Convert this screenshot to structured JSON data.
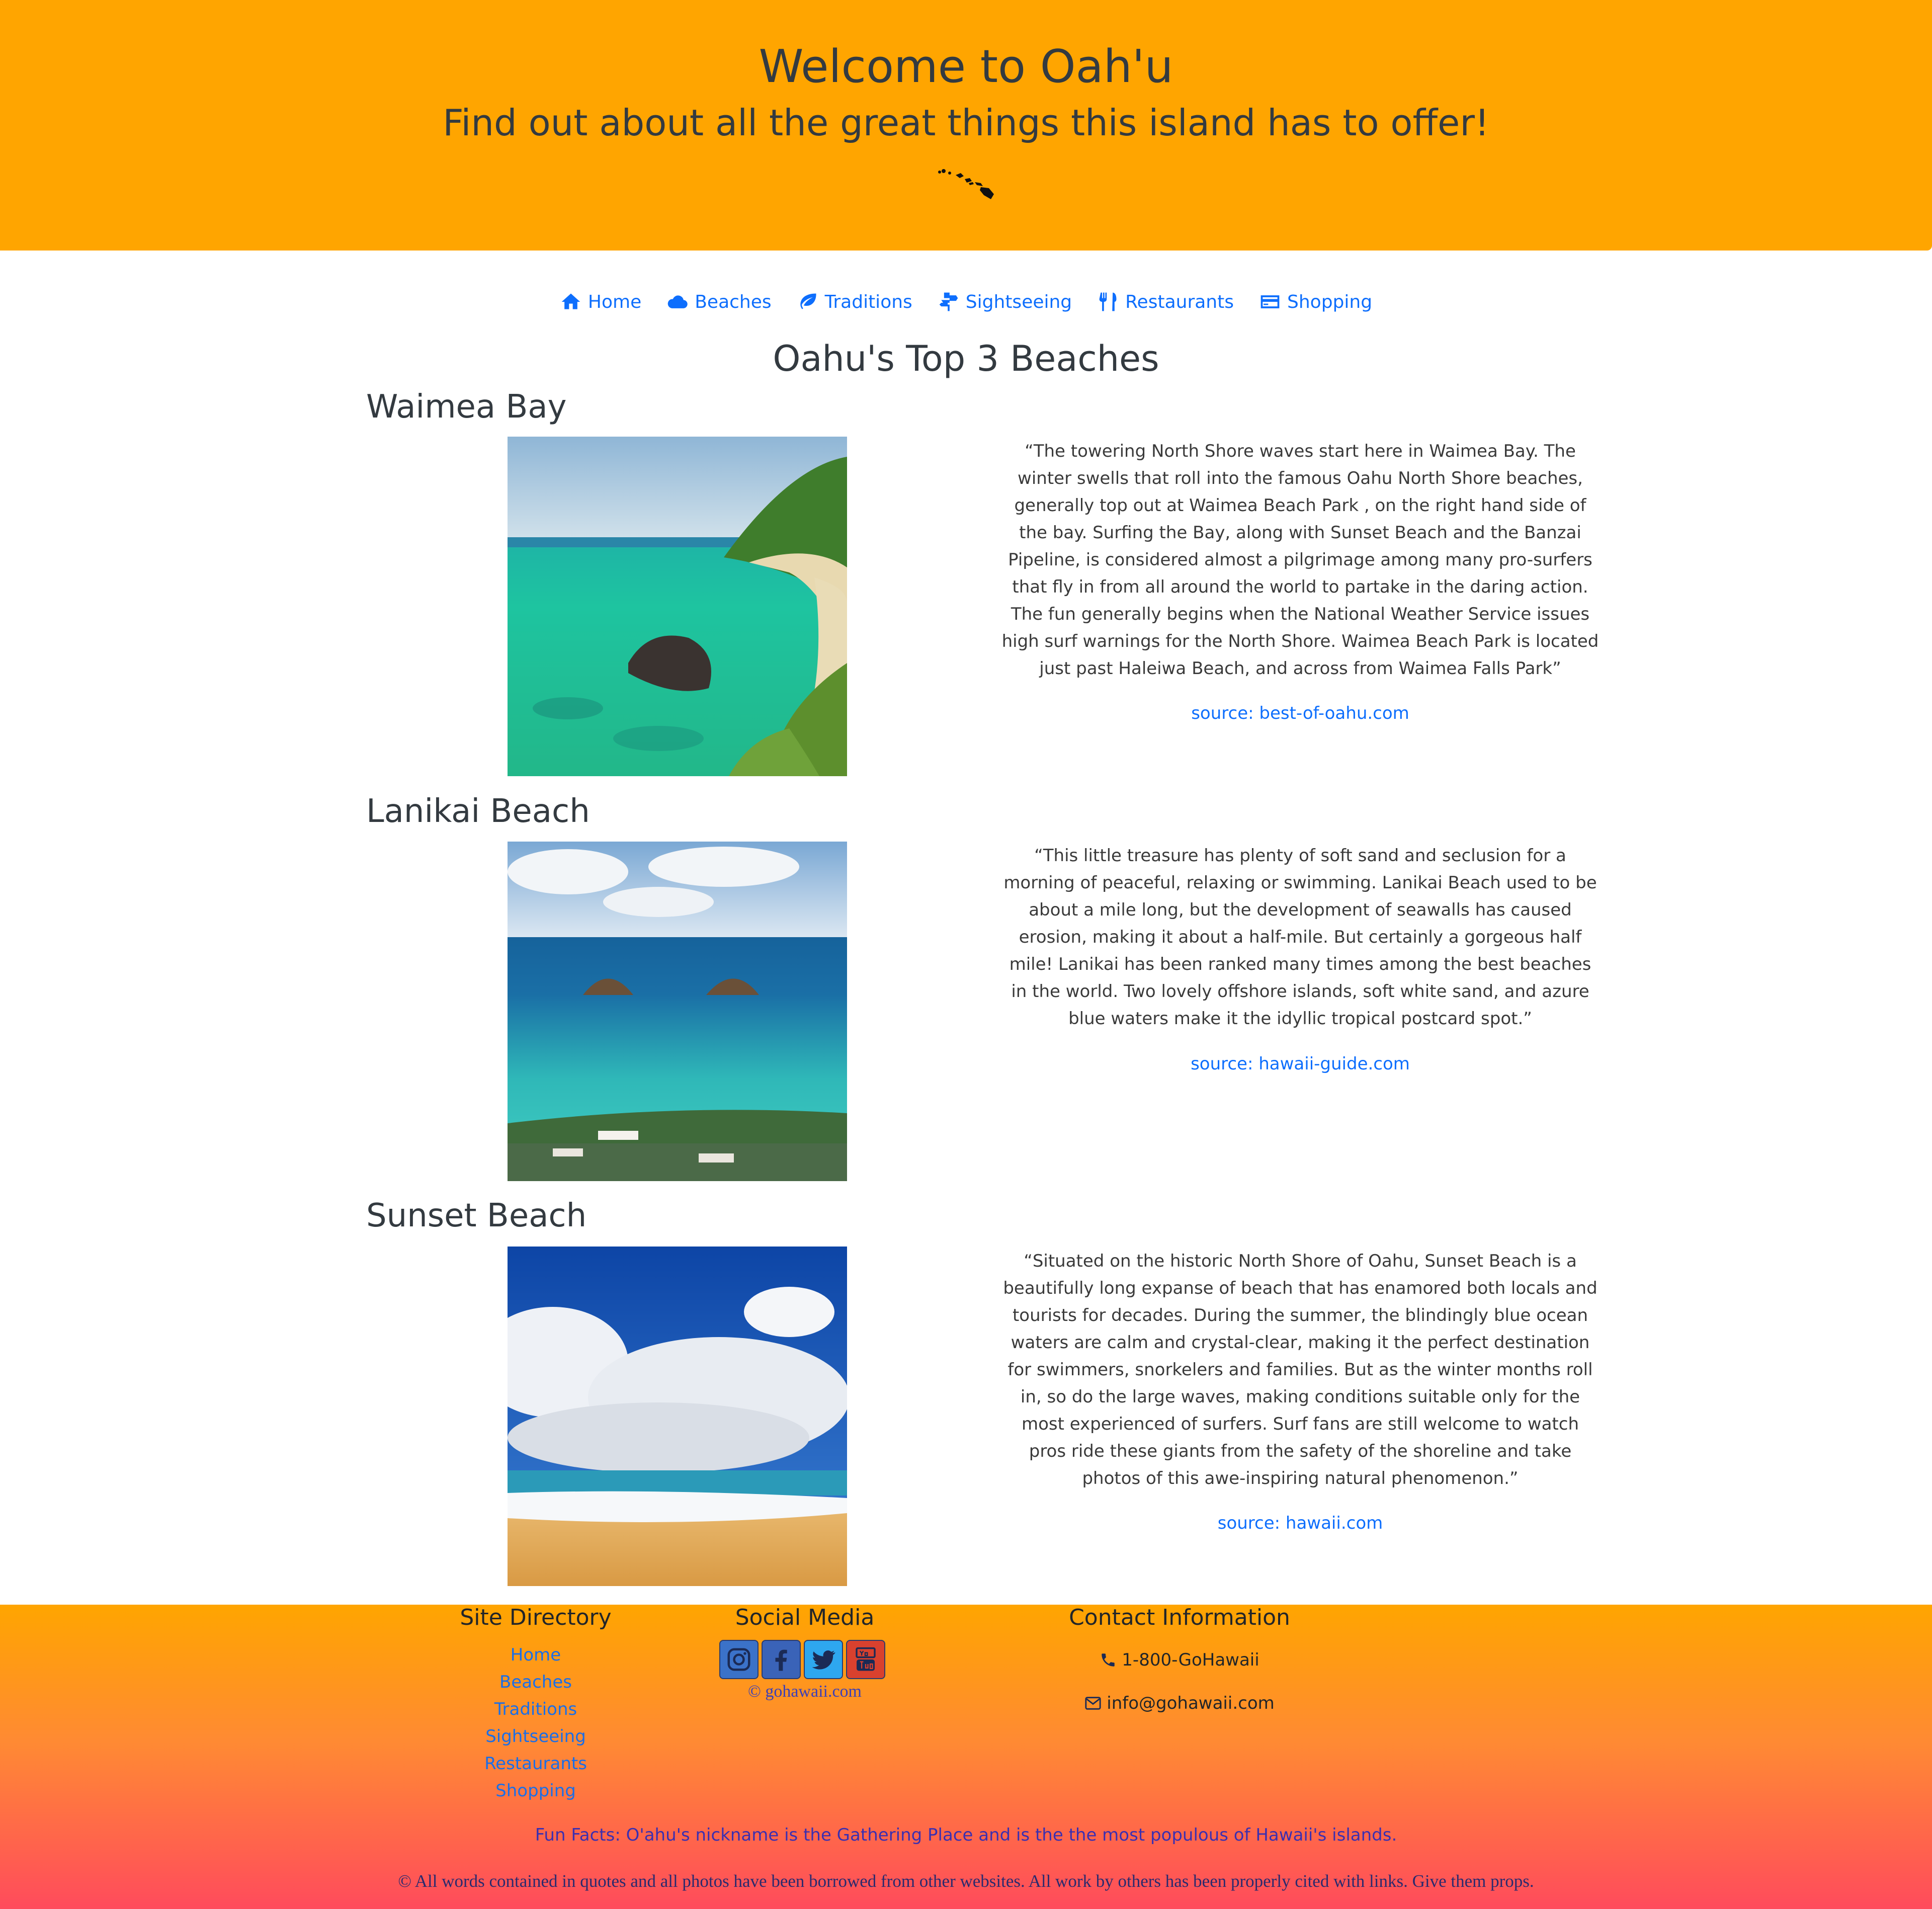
{
  "header": {
    "title": "Welcome to Oah'u",
    "subtitle": "Find out about all the great things this island has to offer!",
    "icon": "hawaiian-islands-icon"
  },
  "nav": [
    {
      "label": "Home",
      "icon": "home-icon"
    },
    {
      "label": "Beaches",
      "icon": "cloud-icon"
    },
    {
      "label": "Traditions",
      "icon": "leaf-icon"
    },
    {
      "label": "Sightseeing",
      "icon": "signpost-icon"
    },
    {
      "label": "Restaurants",
      "icon": "utensils-icon"
    },
    {
      "label": "Shopping",
      "icon": "credit-card-icon"
    }
  ],
  "page_title": "Oahu's Top 3 Beaches",
  "beaches": [
    {
      "name": "Waimea Bay",
      "quote": "“The towering North Shore waves start here in Waimea Bay. The winter swells that roll into the famous Oahu North Shore beaches, generally top out at Waimea Beach Park , on the right hand side of the bay. Surfing the Bay, along with Sunset Beach and the Banzai Pipeline, is considered almost a pilgrimage among many pro-surfers that fly in from all around the world to partake in the daring action. The fun generally begins when the National Weather Service issues high surf warnings for the North Shore. Waimea Beach Park is located just past Haleiwa Beach, and across from Waimea Falls Park”",
      "source": "source: best-of-oahu.com"
    },
    {
      "name": "Lanikai Beach",
      "quote": "“This little treasure has plenty of soft sand and seclusion for a morning of peaceful, relaxing or swimming. Lanikai Beach used to be about a mile long, but the development of seawalls has caused erosion, making it about a half-mile. But certainly a gorgeous half mile! Lanikai has been ranked many times among the best beaches in the world. Two lovely offshore islands, soft white sand, and azure blue waters make it the idyllic tropical postcard spot.”",
      "source": "source: hawaii-guide.com"
    },
    {
      "name": "Sunset Beach",
      "quote": "“Situated on the historic North Shore of Oahu, Sunset Beach is a beautifully long expanse of beach that has enamored both locals and tourists for decades. During the summer, the blindingly blue ocean waters are calm and crystal-clear, making it the perfect destination for swimmers, snorkelers and families. But as the winter months roll in, so do the large waves, making conditions suitable only for the most experienced of surfers. Surf fans are still welcome to watch pros ride these giants from the safety of the shoreline and take photos of this awe-inspiring natural phenomenon.”",
      "source": "source: hawaii.com"
    }
  ],
  "footer": {
    "site_directory": {
      "title": "Site Directory",
      "links": [
        "Home",
        "Beaches",
        "Traditions",
        "Sightseeing",
        "Restaurants",
        "Shopping"
      ]
    },
    "social_media": {
      "title": "Social Media",
      "icons": [
        "instagram-icon",
        "facebook-icon",
        "twitter-icon",
        "youtube-icon"
      ],
      "copyright": "© gohawaii.com"
    },
    "contact": {
      "title": "Contact Information",
      "phone": "1-800-GoHawaii",
      "email": "info@gohawaii.com"
    },
    "fun_facts": "Fun Facts: O'ahu's nickname is the Gathering Place and is the the most populous of Hawaii's islands.",
    "credits": "© All words contained in quotes and all photos have been borrowed from other websites. All work by others has been properly cited with links. Give them props."
  },
  "colors": {
    "header_bg": "#ffa500",
    "link": "#0d6efd",
    "footer_gradient_top": "#ffa500",
    "footer_gradient_bottom": "#ff4b5c"
  }
}
